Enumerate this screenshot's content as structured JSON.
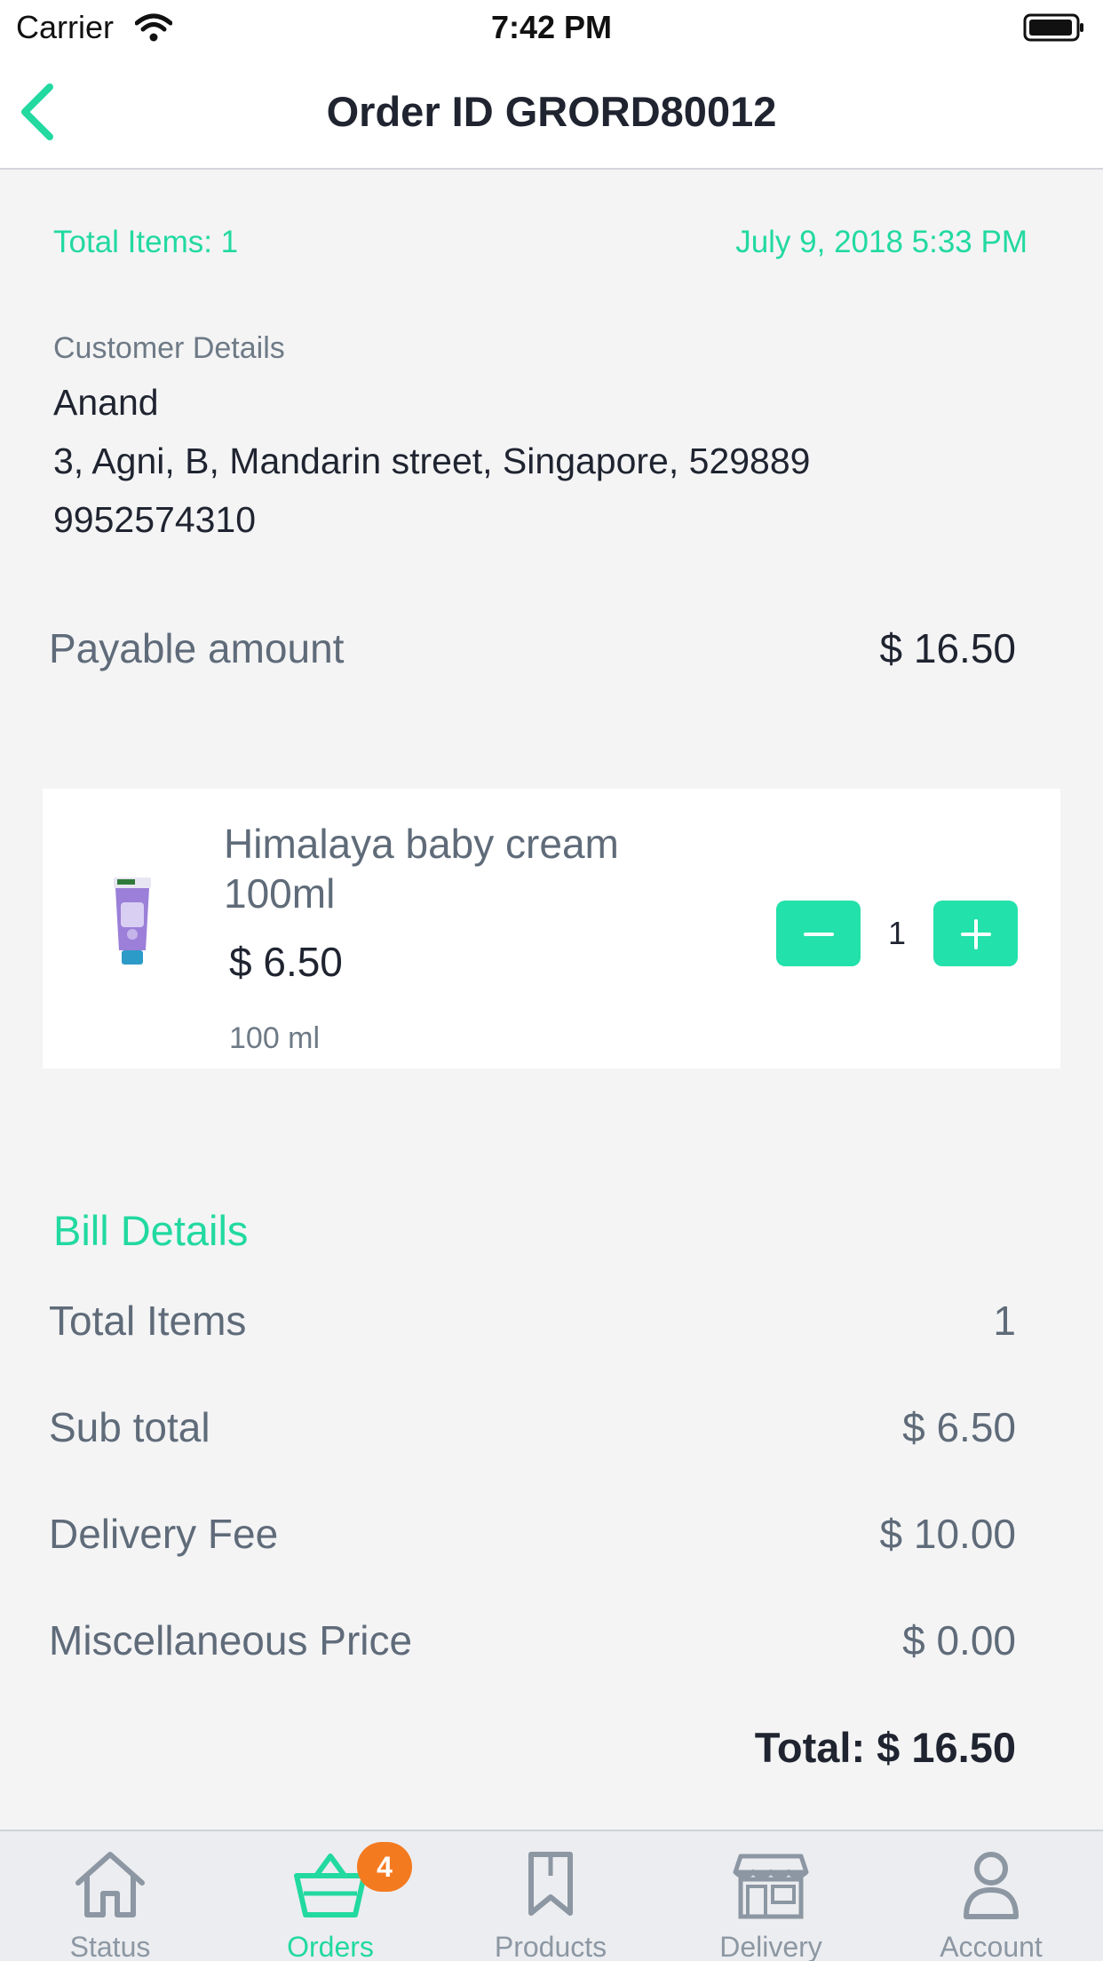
{
  "status_bar": {
    "carrier": "Carrier",
    "time": "7:42 PM"
  },
  "header": {
    "title": "Order ID GRORD80012"
  },
  "order": {
    "total_items_label": "Total Items: 1",
    "datetime": "July 9, 2018 5:33 PM"
  },
  "customer": {
    "label": "Customer Details",
    "name": "Anand",
    "address": "3, Agni, B, Mandarin street, Singapore, 529889",
    "phone": "9952574310"
  },
  "payable": {
    "label": "Payable amount",
    "amount": "$ 16.50"
  },
  "product": {
    "name": "Himalaya baby cream 100ml",
    "price": "$ 6.50",
    "size": "100 ml",
    "quantity": "1"
  },
  "bill": {
    "title": "Bill Details",
    "rows": [
      {
        "label": "Total Items",
        "value": "1"
      },
      {
        "label": "Sub total",
        "value": "$ 6.50"
      },
      {
        "label": "Delivery Fee",
        "value": "$ 10.00"
      },
      {
        "label": "Miscellaneous Price",
        "value": "$ 0.00"
      }
    ],
    "total": "Total: $ 16.50"
  },
  "tabs": [
    {
      "label": "Status",
      "icon": "home-icon"
    },
    {
      "label": "Orders",
      "icon": "basket-icon",
      "badge": "4",
      "active": true
    },
    {
      "label": "Products",
      "icon": "bookmark-icon"
    },
    {
      "label": "Delivery",
      "icon": "store-icon"
    },
    {
      "label": "Account",
      "icon": "user-icon"
    }
  ],
  "colors": {
    "accent": "#22d9a0",
    "badge": "#f47a20",
    "text": "#1f2430",
    "muted": "#5f6b79"
  }
}
